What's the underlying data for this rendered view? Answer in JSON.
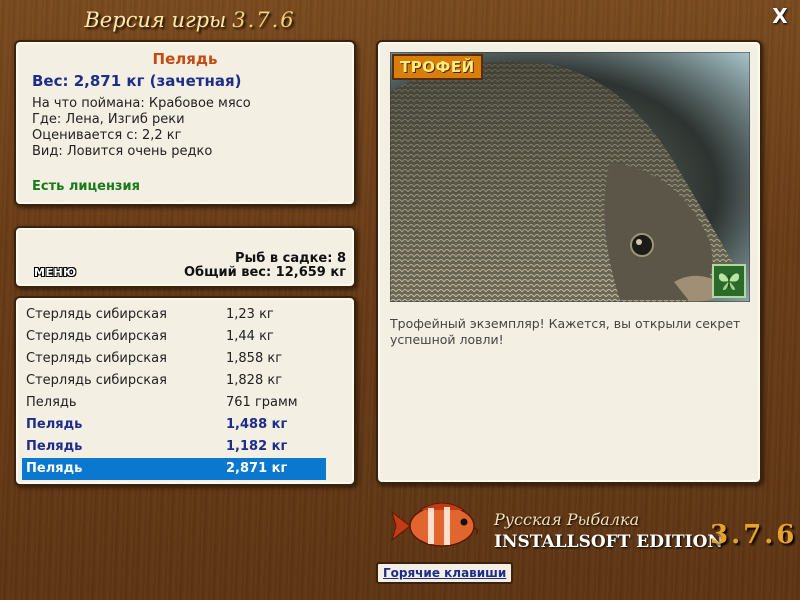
{
  "header": {
    "title": "Версия игры",
    "version": "3.7.6",
    "close_label": "X"
  },
  "info": {
    "fish_name": "Пелядь",
    "weight": "Вес: 2,871 кг (зачетная)",
    "caught_on": "На что поймана: Крабовое мясо",
    "location": "Где: Лена, Изгиб реки",
    "counted_from": "Оценивается с: 2,2 кг",
    "rarity": "Вид: Ловится очень редко",
    "license": "Есть лицензия"
  },
  "summary": {
    "menu_label": "МЕНЮ",
    "count": "Рыб в садке: 8",
    "total_weight": "Общий вес: 12,659 кг"
  },
  "catch_list": [
    {
      "name": "Стерлядь сибирская",
      "weight": "1,23 кг"
    },
    {
      "name": "Стерлядь сибирская",
      "weight": "1,44 кг"
    },
    {
      "name": "Стерлядь сибирская",
      "weight": "1,858 кг"
    },
    {
      "name": "Стерлядь сибирская",
      "weight": "1,828 кг"
    },
    {
      "name": "Пелядь",
      "weight": "761 грамм"
    },
    {
      "name": "Пелядь",
      "weight": "1,488 кг"
    },
    {
      "name": "Пелядь",
      "weight": "1,182 кг"
    },
    {
      "name": "Пелядь",
      "weight": "2,871 кг"
    }
  ],
  "photo": {
    "trophy_label": "ТРОФЕЙ",
    "description": "Трофейный экземпляр! Кажется, вы открыли секрет успешной ловли!",
    "corner_icon": "butterfly-icon"
  },
  "logo": {
    "title": "Русская Рыбалка",
    "edition": "INSTALLSOFT EDITION",
    "version": "3.7.6"
  },
  "footer": {
    "hotkeys_label": "Горячие клавиши"
  }
}
